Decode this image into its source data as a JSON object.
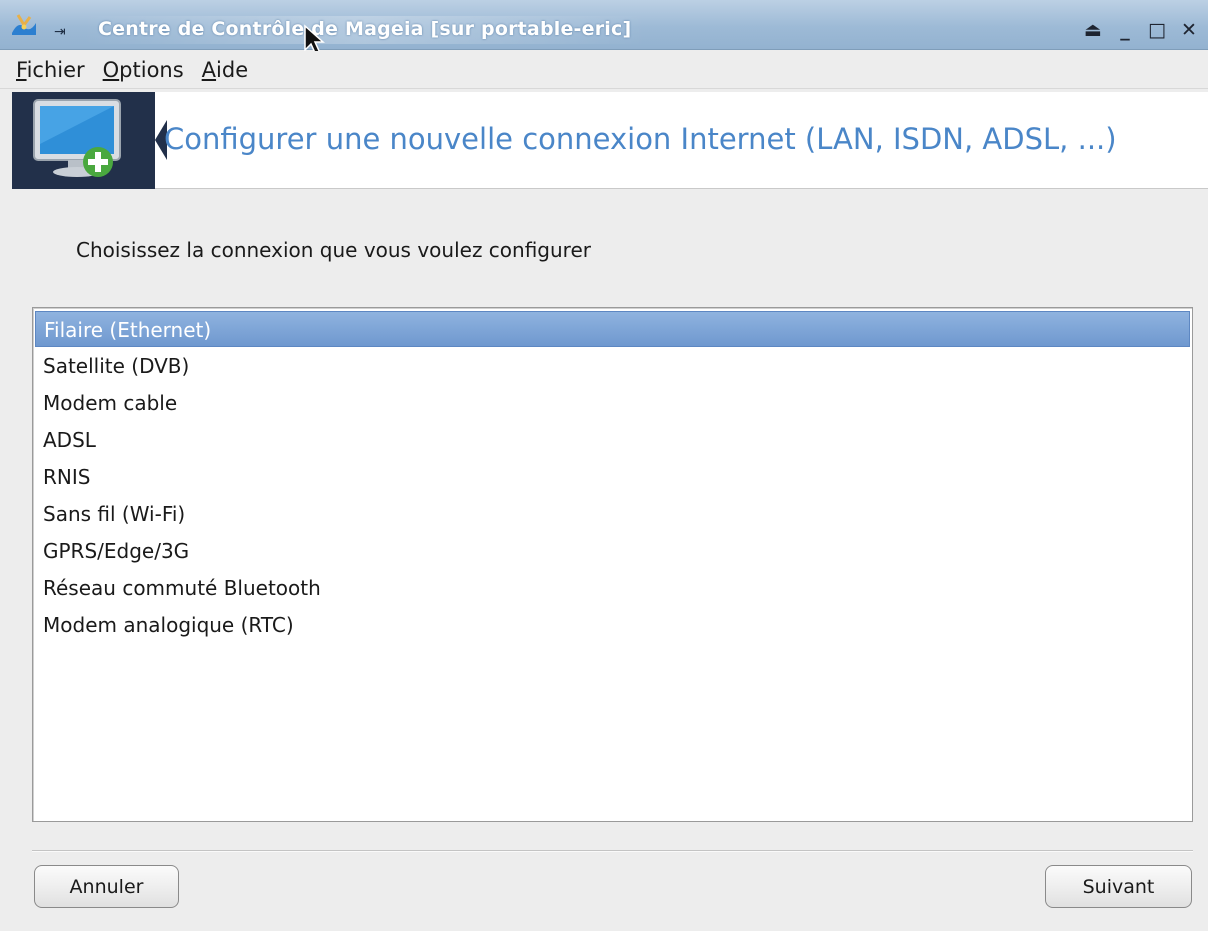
{
  "window": {
    "title": "Centre de Contrôle de Mageia  [sur portable-eric]",
    "controls": [
      {
        "name": "eject",
        "glyph": "⏏"
      },
      {
        "name": "minimize",
        "glyph": "_"
      },
      {
        "name": "maximize",
        "glyph": "□"
      },
      {
        "name": "close",
        "glyph": "✕"
      }
    ]
  },
  "menubar": {
    "items": [
      {
        "mnemonic": "F",
        "rest": "ichier"
      },
      {
        "mnemonic": "O",
        "rest": "ptions"
      },
      {
        "mnemonic": "A",
        "rest": "ide"
      }
    ]
  },
  "banner": {
    "title": "Configurer une nouvelle connexion Internet (LAN, ISDN, ADSL, ...)",
    "icon": "monitor-add-icon"
  },
  "prompt": "Choisissez la connexion que vous voulez configurer",
  "connection_list": {
    "selected_index": 0,
    "items": [
      "Filaire (Ethernet)",
      "Satellite (DVB)",
      "Modem cable",
      "ADSL",
      "RNIS",
      "Sans fil (Wi-Fi)",
      "GPRS/Edge/3G",
      "Réseau commuté Bluetooth",
      "Modem analogique (RTC)"
    ]
  },
  "buttons": {
    "cancel": "Annuler",
    "next": "Suivant"
  },
  "colors": {
    "accent_title": "#4a86c8",
    "selection": "#7aa3d7",
    "banner_icon_bg": "#22304a"
  }
}
